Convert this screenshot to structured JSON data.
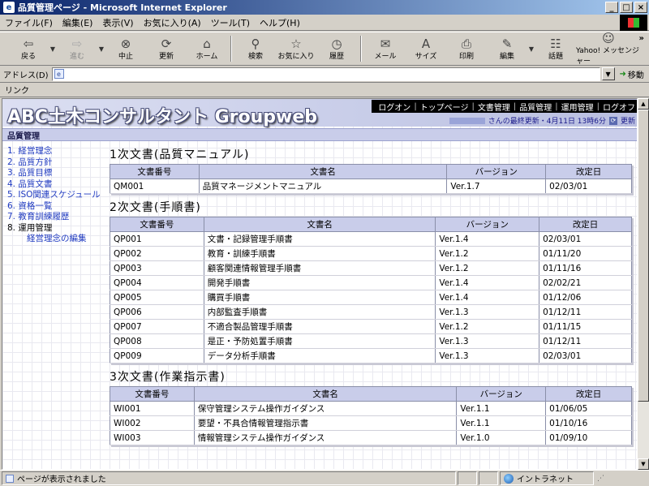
{
  "window": {
    "title": "品質管理ページ - Microsoft Internet Explorer",
    "ie_logo": "e",
    "buttons": {
      "minimize": "_",
      "maximize": "□",
      "close": "×"
    }
  },
  "menubar": [
    "ファイル(F)",
    "編集(E)",
    "表示(V)",
    "お気に入り(A)",
    "ツール(T)",
    "ヘルプ(H)"
  ],
  "toolbar": {
    "back": "戻る",
    "forward": "進む",
    "stop": "中止",
    "refresh": "更新",
    "home": "ホーム",
    "search": "検索",
    "favorites": "お気に入り",
    "history": "履歴",
    "mail": "メール",
    "size": "サイズ",
    "print": "印刷",
    "edit": "編集",
    "discuss": "話題",
    "messenger": "Yahoo! メッセンジャー",
    "more": "»"
  },
  "address": {
    "label": "アドレス(D)",
    "value": "",
    "go": "移動"
  },
  "links": {
    "label": "リンク"
  },
  "site": {
    "title": "ABC土木コンサルタント Groupweb",
    "nav": [
      "ログオン",
      "トップページ",
      "文書管理",
      "品質管理",
      "運用管理",
      "ログオフ"
    ],
    "last_update": "さんの最終更新・4月11日 13時6分",
    "refresh_label": "更新",
    "section": "品質管理"
  },
  "sidebar": {
    "items": [
      "1. 経営理念",
      "2. 品質方針",
      "3. 品質目標",
      "4. 品質文書",
      "5. ISO関連スケジュール",
      "6. 資格一覧",
      "7. 教育訓練履歴"
    ],
    "admin_label": "8. 運用管理",
    "admin_sub": "経営理念の編集"
  },
  "sections": [
    {
      "title": "1次文書(品質マニュアル)",
      "headers": [
        "文書番号",
        "文書名",
        "バージョン",
        "改定日"
      ],
      "rows": [
        [
          "QM001",
          "品質マネージメントマニュアル",
          "Ver.1.7",
          "02/03/01"
        ]
      ]
    },
    {
      "title": "2次文書(手順書)",
      "headers": [
        "文書番号",
        "文書名",
        "バージョン",
        "改定日"
      ],
      "rows": [
        [
          "QP001",
          "文書・記録管理手順書",
          "Ver.1.4",
          "02/03/01"
        ],
        [
          "QP002",
          "教育・訓練手順書",
          "Ver.1.2",
          "01/11/20"
        ],
        [
          "QP003",
          "顧客関連情報管理手順書",
          "Ver.1.2",
          "01/11/16"
        ],
        [
          "QP004",
          "開発手順書",
          "Ver.1.4",
          "02/02/21"
        ],
        [
          "QP005",
          "購買手順書",
          "Ver.1.4",
          "01/12/06"
        ],
        [
          "QP006",
          "内部監査手順書",
          "Ver.1.3",
          "01/12/11"
        ],
        [
          "QP007",
          "不適合製品管理手順書",
          "Ver.1.2",
          "01/11/15"
        ],
        [
          "QP008",
          "是正・予防処置手順書",
          "Ver.1.3",
          "01/12/11"
        ],
        [
          "QP009",
          "データ分析手順書",
          "Ver.1.3",
          "02/03/01"
        ]
      ]
    },
    {
      "title": "3次文書(作業指示書)",
      "headers": [
        "文書番号",
        "文書名",
        "バージョン",
        "改定日"
      ],
      "rows": [
        [
          "WI001",
          "保守管理システム操作ガイダンス",
          "Ver.1.1",
          "01/06/05"
        ],
        [
          "WI002",
          "要望・不具合情報管理指示書",
          "Ver.1.1",
          "01/10/16"
        ],
        [
          "WI003",
          "情報管理システム操作ガイダンス",
          "Ver.1.0",
          "01/09/10"
        ]
      ]
    }
  ],
  "status": {
    "message": "ページが表示されました",
    "zone": "イントラネット"
  }
}
